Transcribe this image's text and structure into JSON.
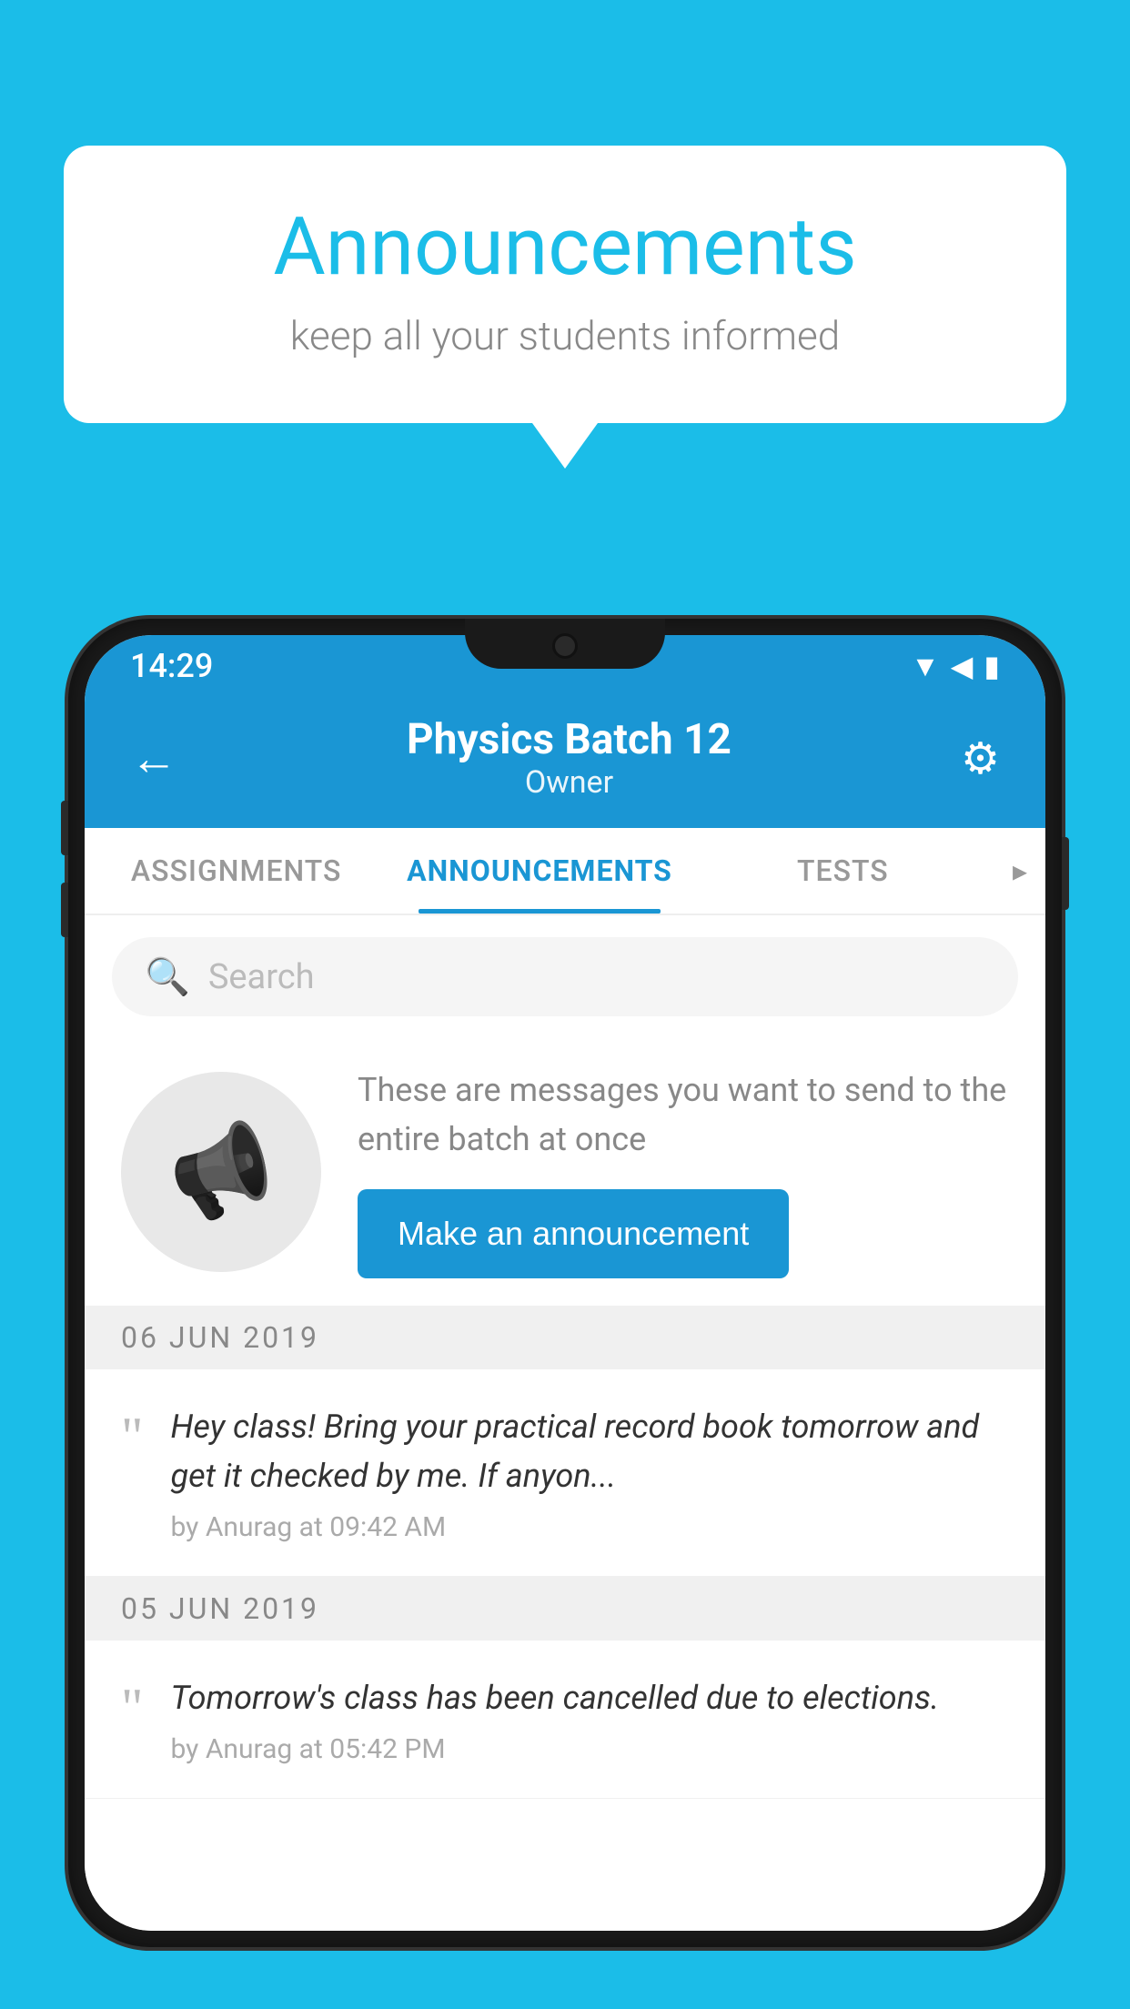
{
  "background": {
    "color": "#1bbde8"
  },
  "speech_bubble": {
    "title": "Announcements",
    "subtitle": "keep all your students informed"
  },
  "phone": {
    "status_bar": {
      "time": "14:29"
    },
    "header": {
      "title": "Physics Batch 12",
      "subtitle": "Owner",
      "back_label": "←",
      "settings_label": "⚙"
    },
    "tabs": [
      {
        "label": "ASSIGNMENTS",
        "active": false
      },
      {
        "label": "ANNOUNCEMENTS",
        "active": true
      },
      {
        "label": "TESTS",
        "active": false
      }
    ],
    "search": {
      "placeholder": "Search"
    },
    "promo": {
      "description": "These are messages you want to send to the entire batch at once",
      "button_label": "Make an announcement"
    },
    "announcements": [
      {
        "date": "06  JUN  2019",
        "text": "Hey class! Bring your practical record book tomorrow and get it checked by me. If anyon...",
        "meta": "by Anurag at 09:42 AM"
      },
      {
        "date": "05  JUN  2019",
        "text": "Tomorrow's class has been cancelled due to elections.",
        "meta": "by Anurag at 05:42 PM"
      }
    ]
  }
}
